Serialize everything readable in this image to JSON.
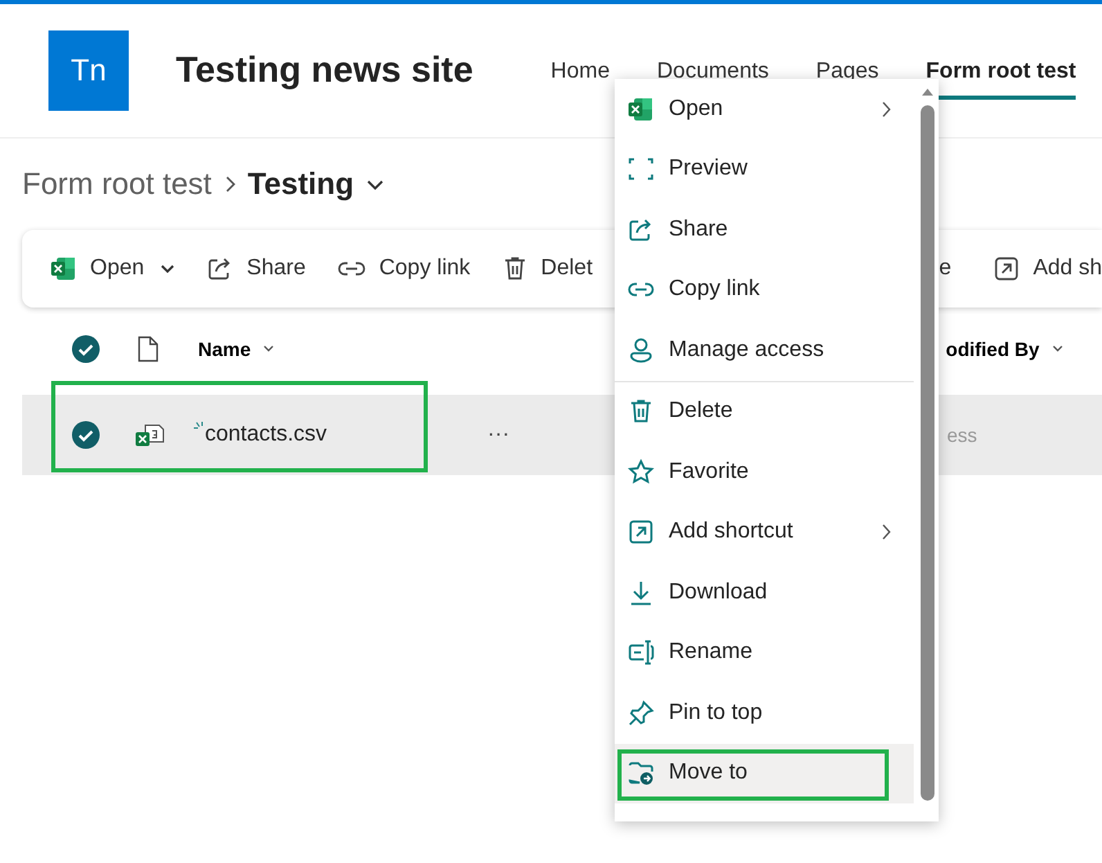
{
  "site": {
    "logo": "Tn",
    "title": "Testing news site"
  },
  "nav": [
    {
      "label": "Home",
      "selected": false
    },
    {
      "label": "Documents",
      "selected": false
    },
    {
      "label": "Pages",
      "selected": false
    },
    {
      "label": "Form root test",
      "selected": true
    }
  ],
  "breadcrumb": {
    "parent": "Form root test",
    "current": "Testing"
  },
  "toolbar": {
    "left": [
      {
        "label": "Open",
        "dropdown": true
      },
      {
        "label": "Share",
        "dropdown": false
      },
      {
        "label": "Copy link",
        "dropdown": false
      },
      {
        "label": "Delet",
        "dropdown": false
      }
    ],
    "right": [
      {
        "label": "e",
        "dropdown": false
      },
      {
        "label": "Add sh",
        "dropdown": false
      }
    ]
  },
  "columns": {
    "all_checked": true,
    "name": "Name",
    "modified_by": "odified By"
  },
  "rows": [
    {
      "checked": true,
      "highlighted": true,
      "name": "contacts.csv",
      "more": "···",
      "modified_by": "ess"
    }
  ],
  "menu": {
    "groups": [
      [
        {
          "label": "Open",
          "submenu": true,
          "selected": false,
          "highlighted": false
        },
        {
          "label": "Preview",
          "submenu": false,
          "selected": false,
          "highlighted": false
        },
        {
          "label": "Share",
          "submenu": false,
          "selected": false,
          "highlighted": false
        },
        {
          "label": "Copy link",
          "submenu": false,
          "selected": false,
          "highlighted": false
        },
        {
          "label": "Manage access",
          "submenu": false,
          "selected": false,
          "highlighted": false
        }
      ],
      [
        {
          "label": "Delete",
          "submenu": false,
          "selected": false,
          "highlighted": false
        },
        {
          "label": "Favorite",
          "submenu": false,
          "selected": false,
          "highlighted": false
        },
        {
          "label": "Add shortcut",
          "submenu": true,
          "selected": false,
          "highlighted": false
        },
        {
          "label": "Download",
          "submenu": false,
          "selected": false,
          "highlighted": false
        },
        {
          "label": "Rename",
          "submenu": false,
          "selected": false,
          "highlighted": false
        },
        {
          "label": "Pin to top",
          "submenu": false,
          "selected": false,
          "highlighted": false
        },
        {
          "label": "Move to",
          "submenu": false,
          "selected": true,
          "highlighted": true
        }
      ]
    ]
  }
}
